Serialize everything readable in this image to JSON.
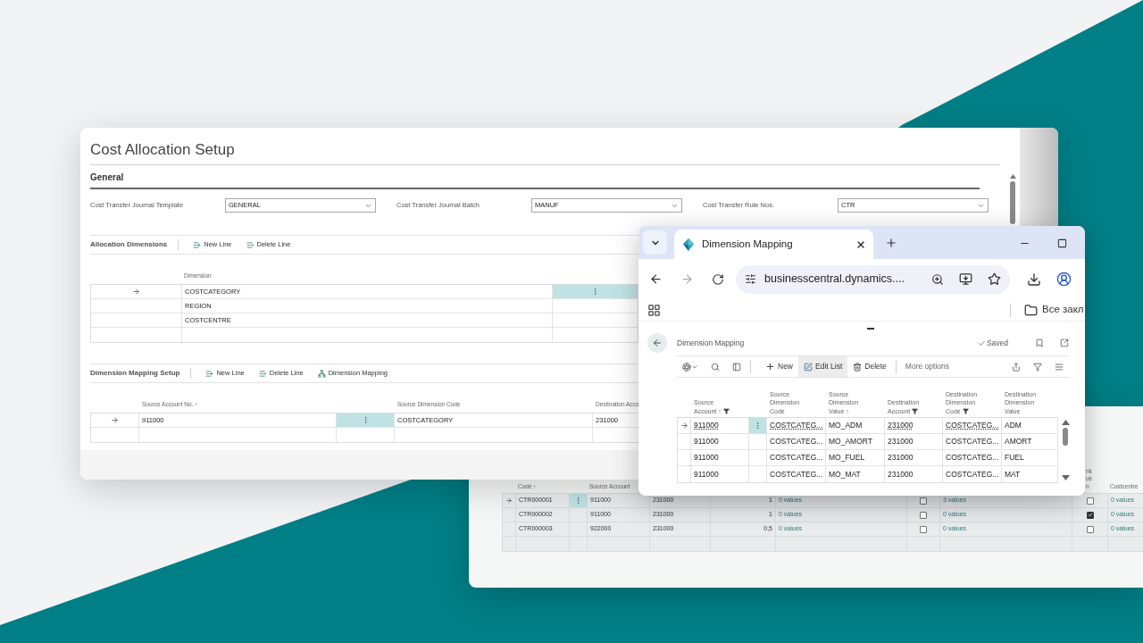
{
  "setup_window": {
    "title": "Cost Allocation Setup",
    "section": "General",
    "fields": [
      {
        "label": "Cost Transfer Journal Template",
        "value": "GENERAL"
      },
      {
        "label": "Cost Transfer Journal Batch",
        "value": "MANUF"
      },
      {
        "label": "Cost Transfer Rule Nos.",
        "value": "CTR"
      }
    ],
    "allocation_dimensions": {
      "title": "Allocation Dimensions",
      "actions": [
        {
          "label": "New Line",
          "kind": "new"
        },
        {
          "label": "Delete Line",
          "kind": "delete"
        }
      ],
      "columns": [
        "Dimension"
      ],
      "rows": [
        {
          "dimension": "COSTCATEGORY",
          "selected": true
        },
        {
          "dimension": "REGION",
          "selected": false
        },
        {
          "dimension": "COSTCENTRE",
          "selected": false
        }
      ]
    },
    "dimension_mapping_setup": {
      "title": "Dimension Mapping Setup",
      "actions": [
        {
          "label": "New Line",
          "kind": "new"
        },
        {
          "label": "Delete Line",
          "kind": "delete"
        },
        {
          "label": "Dimension Mapping",
          "kind": "mapping"
        }
      ],
      "columns": [
        "Source Account No. ↑",
        "Source Dimension Code",
        "Destination Acco"
      ],
      "rows": [
        {
          "source_account": "911000",
          "source_dimension_code": "COSTCATEGORY",
          "destination_account": "231000",
          "selected": true
        }
      ]
    }
  },
  "rules_window": {
    "columns": [
      {
        "label": "Code ↑"
      },
      {
        "label": "Source Account"
      },
      {
        "label": "nk\nue\nn"
      },
      {
        "label": "Costcentre"
      }
    ],
    "rows": [
      {
        "code": "CTR000001",
        "selected": true,
        "source_account": "911000",
        "destination_account": "231000",
        "quantity": "1",
        "values_1": "0 values",
        "checked_1": false,
        "values_2": "3 values",
        "checked_2": false,
        "costcentre": "0 values"
      },
      {
        "code": "CTR000002",
        "selected": false,
        "source_account": "911000",
        "destination_account": "231000",
        "quantity": "1",
        "values_1": "0 values",
        "checked_1": false,
        "values_2": "0 values",
        "checked_2": true,
        "costcentre": "0 values"
      },
      {
        "code": "CTR000003",
        "selected": false,
        "source_account": "922000",
        "destination_account": "231000",
        "quantity": "0,5",
        "values_1": "0 values",
        "checked_1": false,
        "values_2": "0 values",
        "checked_2": false,
        "costcentre": "0 values"
      }
    ]
  },
  "browser": {
    "tab_title": "Dimension Mapping",
    "url": "businesscentral.dynamics....",
    "bookmarks_folder": "Все закл",
    "page": {
      "title": "Dimension Mapping",
      "status": "Saved",
      "actions": [
        {
          "label": "New",
          "kind": "new",
          "selected": false
        },
        {
          "label": "Edit List",
          "kind": "edit",
          "selected": true
        },
        {
          "label": "Delete",
          "kind": "delete",
          "selected": false
        },
        {
          "label": "More options",
          "kind": "more",
          "selected": false
        }
      ],
      "columns": [
        {
          "label": "Source\nAccount ↑",
          "filter": true
        },
        {
          "label": "Source\nDimension\nCode",
          "filter": false
        },
        {
          "label": "Source\nDimension\nValue ↑",
          "filter": false
        },
        {
          "label": "Destination\nAccount",
          "filter": true
        },
        {
          "label": "Destination\nDimension\nCode",
          "filter": true
        },
        {
          "label": "Destination\nDimension\nValue",
          "filter": false
        }
      ],
      "rows": [
        {
          "cells": [
            "911000",
            "COSTCATEG...",
            "MO_ADM",
            "231000",
            "COSTCATEG...",
            "ADM"
          ],
          "selected": true
        },
        {
          "cells": [
            "911000",
            "COSTCATEG...",
            "MO_AMORT",
            "231000",
            "COSTCATEG...",
            "AMORT"
          ],
          "selected": false
        },
        {
          "cells": [
            "911000",
            "COSTCATEG...",
            "MO_FUEL",
            "231000",
            "COSTCATEG...",
            "FUEL"
          ],
          "selected": false
        },
        {
          "cells": [
            "911000",
            "COSTCATEG...",
            "MO_MAT",
            "231000",
            "COSTCATEG...",
            "MAT"
          ],
          "selected": false
        }
      ]
    }
  }
}
